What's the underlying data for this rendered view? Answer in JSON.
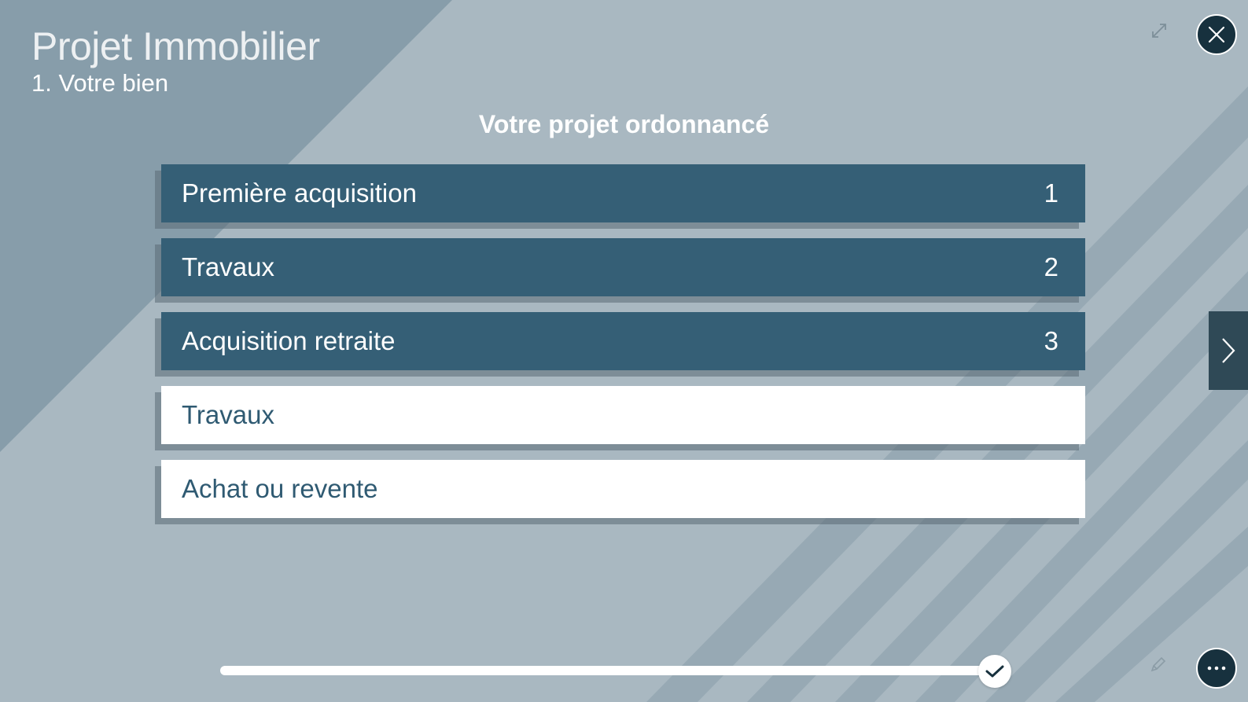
{
  "app": {
    "title": "Projet Immobilier",
    "subtitle": "1. Votre bien"
  },
  "main": {
    "heading": "Votre projet ordonnancé",
    "items": [
      {
        "label": "Première acquisition",
        "rank": "1",
        "selected": true
      },
      {
        "label": "Travaux",
        "rank": "2",
        "selected": true
      },
      {
        "label": "Acquisition retraite",
        "rank": "3",
        "selected": true
      },
      {
        "label": "Travaux",
        "rank": "",
        "selected": false
      },
      {
        "label": "Achat ou revente",
        "rank": "",
        "selected": false
      }
    ]
  },
  "progress": {
    "fraction": 0.985
  },
  "icons": {
    "close": "close-icon",
    "more": "more-icon",
    "expand": "expand-icon",
    "edit": "pencil-icon",
    "next": "chevron-right-icon",
    "progress": "check-icon"
  },
  "colors": {
    "background": "#a9b8c1",
    "selected_item": "#355f76",
    "unselected_item": "#ffffff",
    "unselected_text": "#2f5a72",
    "button_dark": "#17313e"
  }
}
